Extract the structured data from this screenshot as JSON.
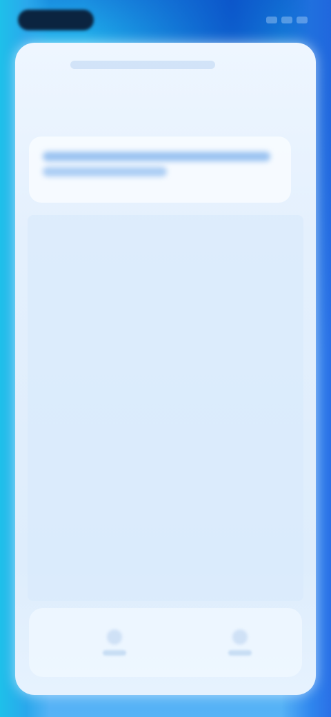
{
  "status_bar": {
    "time": "",
    "indicators": [
      "signal",
      "wifi",
      "battery"
    ]
  },
  "header": {
    "title": ""
  },
  "page": {
    "title": ""
  },
  "info_box": {
    "line1": "",
    "line2": ""
  },
  "bottom_nav": {
    "items": [
      {
        "label": "",
        "icon": "nav-icon-left"
      },
      {
        "label": "",
        "icon": "nav-icon-right"
      }
    ]
  },
  "colors": {
    "accent": "#3b86e0",
    "background_top": "#1a8fe0",
    "background_bottom": "#56b3f6",
    "card": "#e4f0fd"
  }
}
